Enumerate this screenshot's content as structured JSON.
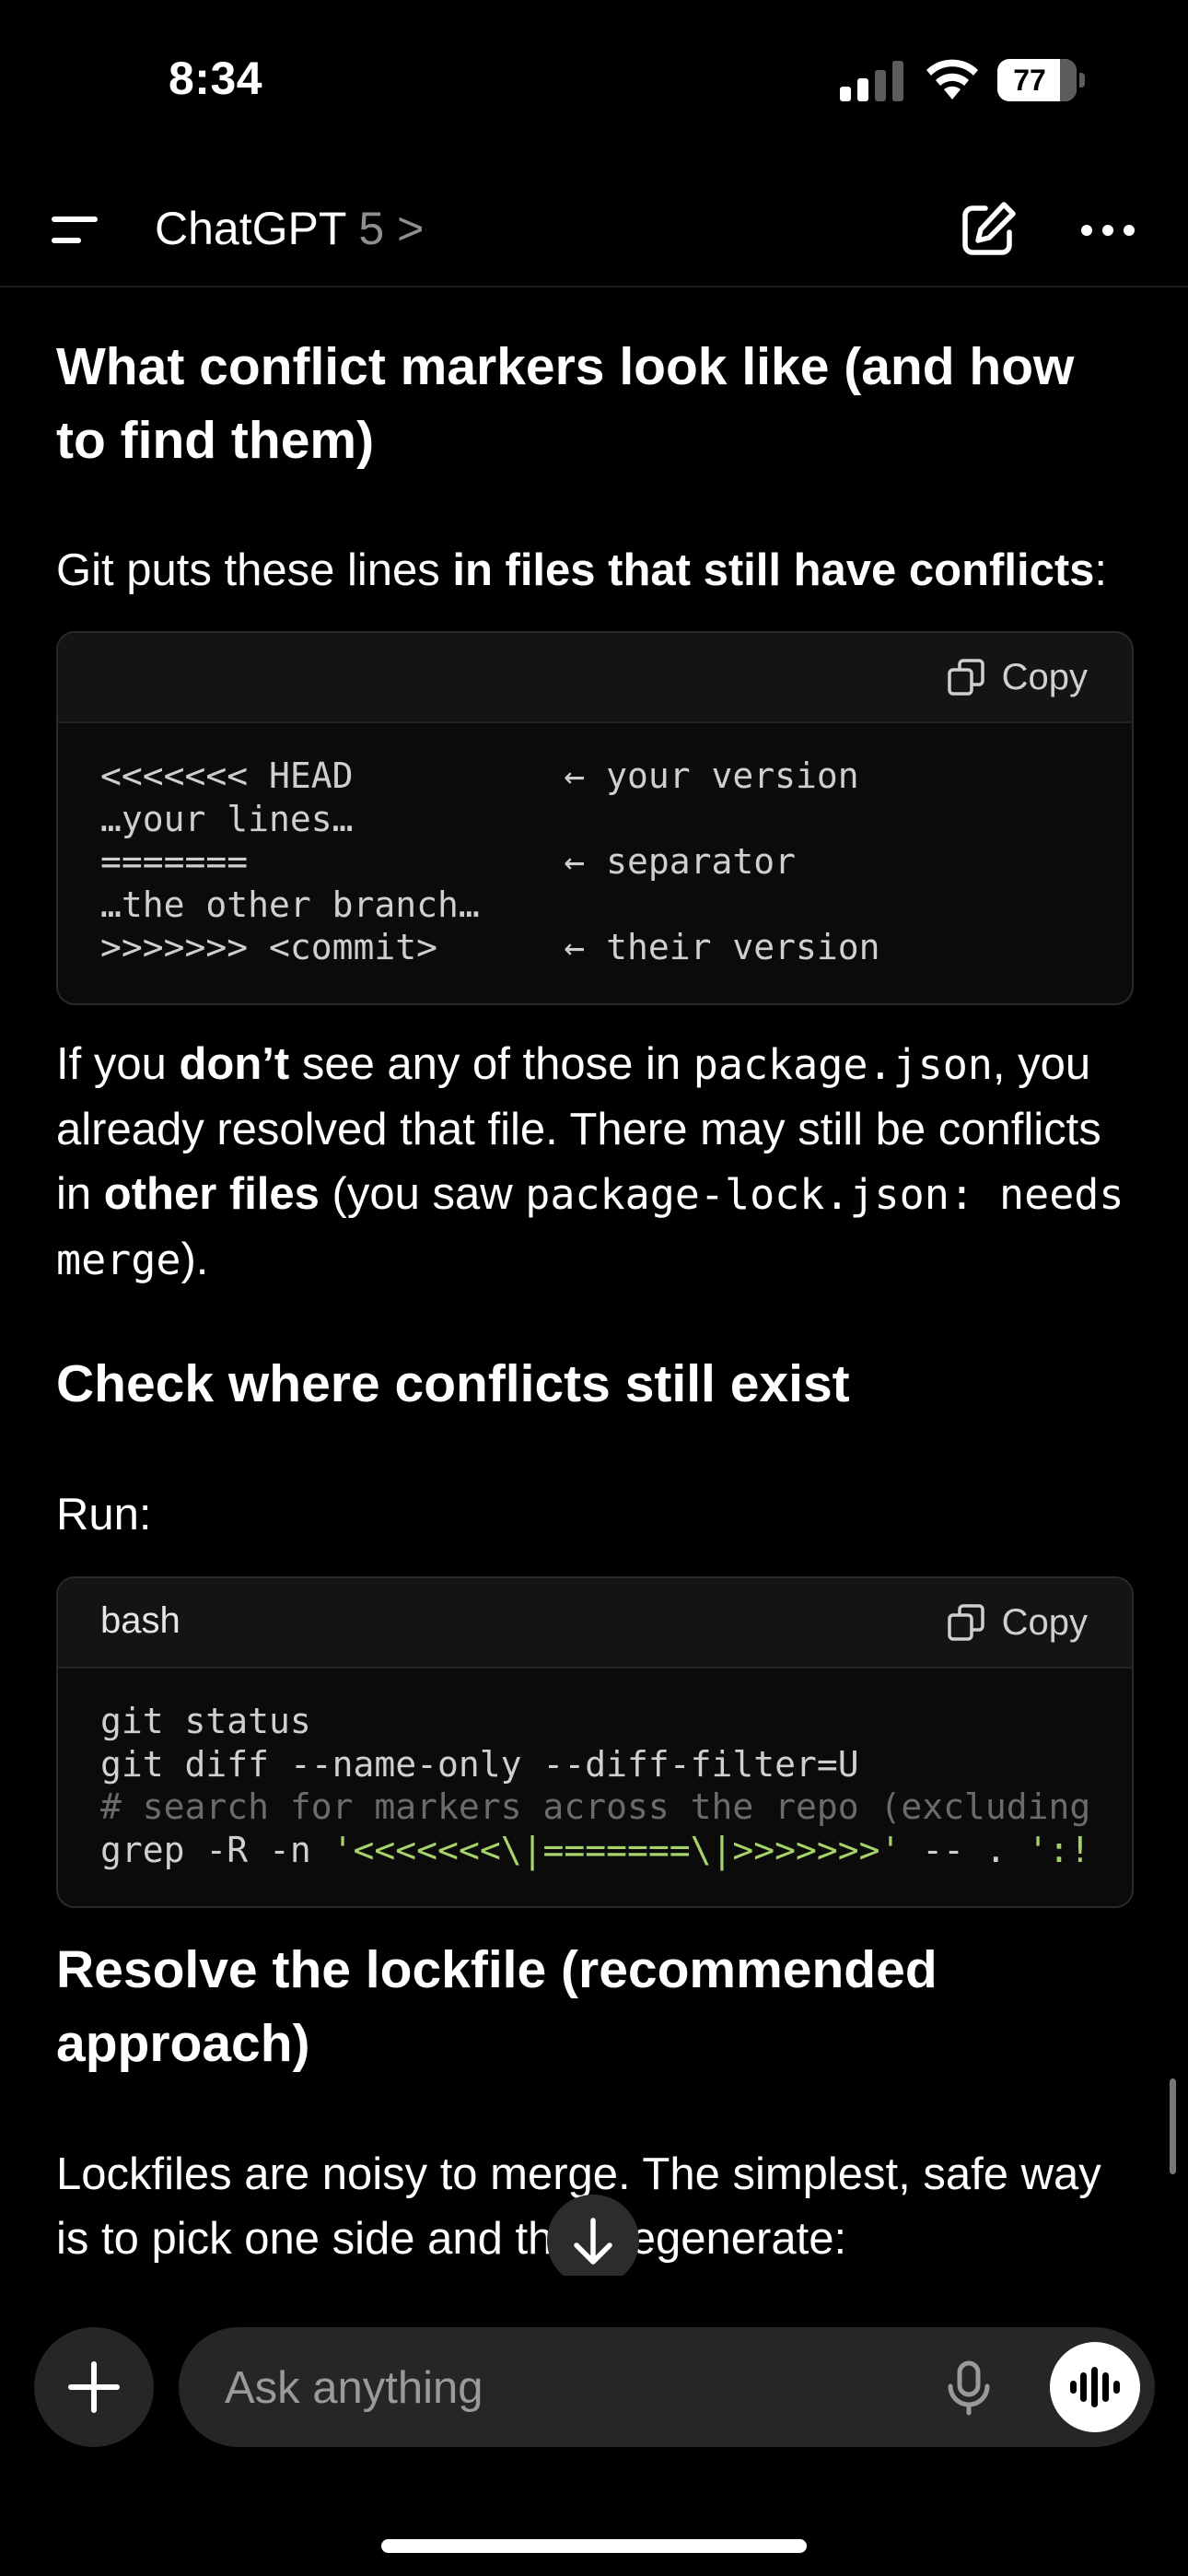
{
  "status_bar": {
    "time": "8:34",
    "battery": "77"
  },
  "header": {
    "app_title": "ChatGPT",
    "model": "5",
    "chevron": ">"
  },
  "icons": {
    "menu": "menu-icon",
    "edit": "new-chat-icon",
    "more": "more-icon",
    "copy": "copy-icon",
    "scroll_down": "arrow-down-icon",
    "plus": "plus-icon",
    "mic": "mic-icon",
    "voice": "voice-mode-icon"
  },
  "sections": {
    "markers_heading": "What conflict markers look like (and how to find them)",
    "markers_intro_pre": "Git puts these lines ",
    "markers_intro_bold": "in files that still have conflicts",
    "markers_intro_post": ":",
    "code1": {
      "lang": "",
      "copy_label": "Copy",
      "lines": [
        "<<<<<<< HEAD          ← your version",
        "…your lines…",
        "=======               ← separator",
        "…the other branch…",
        ">>>>>>> <commit>      ← their version"
      ]
    },
    "resolved_p": {
      "t1": "If you ",
      "b1": "don’t",
      "t2": " see any of those in ",
      "c1": "package.json",
      "t3": ", you already resolved that file. There may still be conflicts in ",
      "b2": "other files",
      "t4": " (you saw ",
      "c2": "package-lock.json: needs merge",
      "t5": ")."
    },
    "check_heading": "Check where conflicts still exist",
    "run_label": "Run:",
    "code2": {
      "lang": "bash",
      "copy_label": "Copy",
      "line1": "git status",
      "line2": "git diff --name-only --diff-filter=U",
      "line3": "# search for markers across the repo (excluding",
      "line4_pre": "grep -R -n ",
      "line4_str": "'<<<<<<<\\|=======\\|>>>>>>>'",
      "line4_post": " -- . ",
      "line4_tail": "':!"
    },
    "lockfile_heading": "Resolve the lockfile (recommended approach)",
    "lockfile_p": "Lockfiles are noisy to merge. The simplest, safe way is to pick one side and then regenerate:"
  },
  "composer": {
    "placeholder": "Ask anything"
  }
}
